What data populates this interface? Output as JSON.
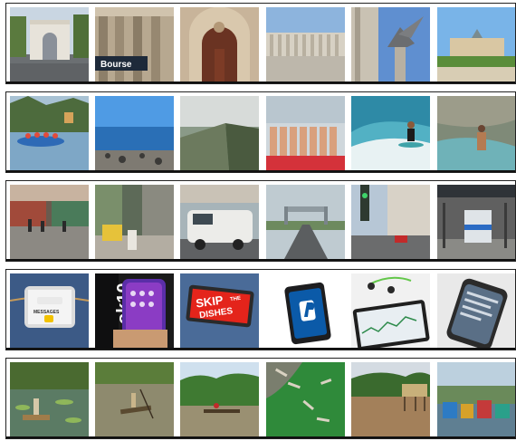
{
  "grid": {
    "rows": [
      {
        "theme": "landmark architecture",
        "thumbs": [
          "arch-gate",
          "bourse-building",
          "carved-doorway",
          "colonnade-square",
          "winged-lion-column",
          "palace-lawn"
        ]
      },
      {
        "theme": "water and people",
        "thumbs": [
          "raft-river",
          "beach-shore",
          "coastal-wall",
          "rowing-team",
          "surfer-wave",
          "water-slide"
        ]
      },
      {
        "theme": "streets and transport",
        "thumbs": [
          "market-street",
          "rickshaw-lane",
          "white-van",
          "highway-gate",
          "city-traffic",
          "bus-station"
        ]
      },
      {
        "theme": "phones and devices",
        "thumbs": [
          "phone-in-pocket",
          "phone-in-hand",
          "phone-skip-dishes",
          "paypal-phone",
          "earbuds-tablet",
          "phone-on-desk"
        ]
      },
      {
        "theme": "rivers and boats",
        "thumbs": [
          "river-raft-wading",
          "boatman-river",
          "longboat-jungle",
          "aerial-boats",
          "stilt-houses-river",
          "fishing-harbor"
        ]
      }
    ]
  },
  "texts": {
    "bourse": "Bourse",
    "messages_app": "MESSAGES",
    "okio_brand": "ok10",
    "skip_line1": "SKIP",
    "skip_line2": "THE",
    "skip_line3": "DISHES"
  }
}
